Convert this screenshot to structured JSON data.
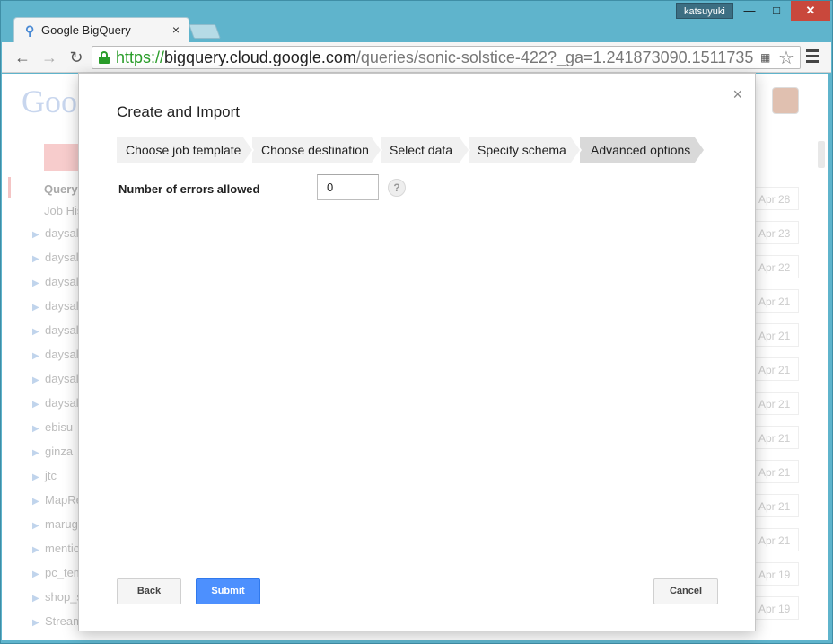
{
  "window": {
    "user": "katsuyuki",
    "min_glyph": "—",
    "max_glyph": "□",
    "close_glyph": "✕"
  },
  "browser": {
    "tab_title": "Google BigQuery",
    "tab_close": "×",
    "url_scheme": "https://",
    "url_host": "bigquery.cloud.google.com",
    "url_path": "/queries/sonic-solstice-422?_ga=1.241873090.1511735"
  },
  "background": {
    "logo": "Goo",
    "nav_items": [
      "Query",
      "Job His"
    ],
    "datasets": [
      "daysal",
      "daysal",
      "daysal",
      "daysal",
      "daysal",
      "daysal",
      "daysal",
      "daysal",
      "ebisu",
      "ginza",
      "jtc",
      "MapRe",
      "maruge",
      "mentio",
      "pc_tem",
      "shop_s",
      "Stream"
    ],
    "dates": [
      "Apr 28",
      "Apr 23",
      "Apr 22",
      "Apr 21",
      "Apr 21",
      "Apr 21",
      "Apr 21",
      "Apr 21",
      "Apr 21",
      "Apr 21",
      "Apr 21",
      "Apr 19",
      "Apr 19"
    ]
  },
  "modal": {
    "title": "Create and Import",
    "close": "×",
    "steps": [
      {
        "label": "Choose job template",
        "active": false
      },
      {
        "label": "Choose destination",
        "active": false
      },
      {
        "label": "Select data",
        "active": false
      },
      {
        "label": "Specify schema",
        "active": false
      },
      {
        "label": "Advanced options",
        "active": true
      }
    ],
    "errors_label": "Number of errors allowed",
    "errors_value": "0",
    "help": "?",
    "back": "Back",
    "submit": "Submit",
    "cancel": "Cancel"
  },
  "colors": {
    "frame": "#5fb4cc",
    "submit": "#4d90fe",
    "secure": "#2a9d2a"
  }
}
